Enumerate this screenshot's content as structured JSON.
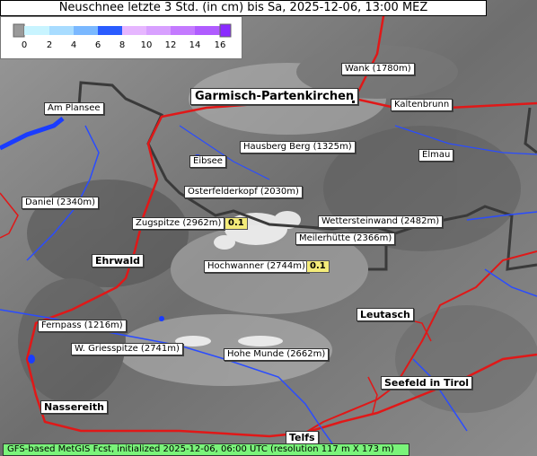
{
  "title": "Neuschnee letzte 3 Std. (in cm) bis Sa, 2025-12-06, 13:00 MEZ",
  "legend": {
    "ticks": [
      "0",
      "2",
      "4",
      "6",
      "8",
      "10",
      "12",
      "14",
      "16"
    ],
    "colors": [
      "#c8f4ff",
      "#a8dcff",
      "#7ab8ff",
      "#4f8eff",
      "#2a5cff",
      "#e6b6ff",
      "#cc88ff",
      "#b05cff",
      "#8a2aff"
    ]
  },
  "places": {
    "garmisch": "Garmisch-Partenkirchen",
    "wank": "Wank (1780m)",
    "kaltenbrunn": "Kaltenbrunn",
    "am_plansee": "Am Plansee",
    "hausberg": "Hausberg Berg (1325m)",
    "eibsee": "Eibsee",
    "elmau": "Elmau",
    "osterfelderkopf": "Osterfelderkopf (2030m)",
    "daniel": "Daniel (2340m)",
    "zugspitze": "Zugspitze (2962m)",
    "wettersteinwand": "Wettersteinwand (2482m)",
    "meilerhuette": "Meilerhütte (2366m)",
    "ehrwald": "Ehrwald",
    "hochwanner": "Hochwanner (2744m)",
    "leutasch": "Leutasch",
    "fernpass": "Fernpass (1216m)",
    "w_griesspitze": "W. Griesspitze (2741m)",
    "hohe_munde": "Hohe Munde (2662m)",
    "seefeld": "Seefeld in Tirol",
    "nassereith": "Nassereith",
    "telfs": "Telfs"
  },
  "values": {
    "zugspitze": "0.1",
    "hochwanner": "0.1"
  },
  "footer": "GFS-based MetGIS Fcst, initialized 2025-12-06, 06:00 UTC  (resolution 117 m X 173 m)"
}
